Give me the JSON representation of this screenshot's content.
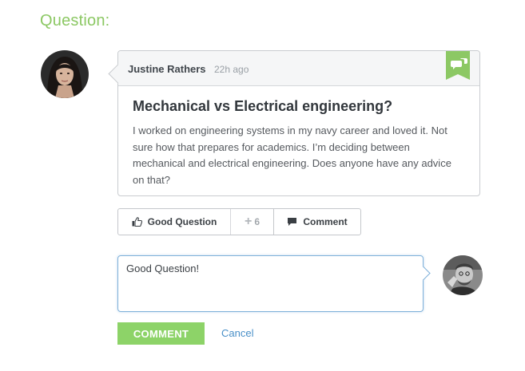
{
  "section": {
    "title": "Question:"
  },
  "question": {
    "author": "Justine Rathers",
    "time": "22h ago",
    "title": "Mechanical vs Electrical engineering?",
    "body": "I worked on engineering systems in my navy career and loved it. Not sure how that prepares for academics. I’m deciding between mechanical and electrical engineering. Does anyone have any advice on that?"
  },
  "actions": {
    "good_question_label": "Good Question",
    "vote_count": "6",
    "comment_label": "Comment"
  },
  "reply": {
    "value": "Good Question!",
    "submit_label": "COMMENT",
    "cancel_label": "Cancel"
  },
  "icons": {
    "flag": "comment-flag-icon",
    "thumb": "thumbs-up-icon",
    "plus": "plus-icon",
    "comment": "speech-bubble-icon"
  },
  "colors": {
    "accent_green": "#8cc864",
    "button_green": "#8dd368",
    "link_blue": "#4a90c8",
    "focus_blue": "#7fb1da"
  }
}
